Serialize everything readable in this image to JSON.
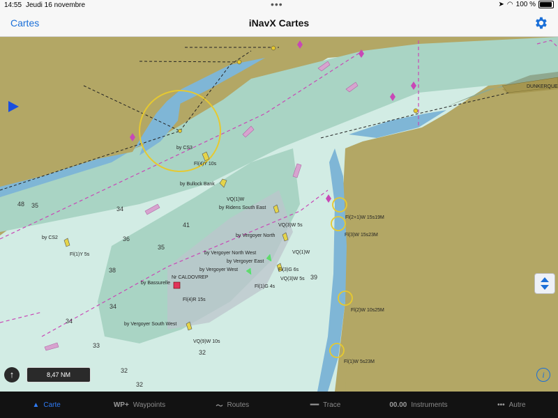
{
  "status": {
    "time": "14:55",
    "date": "Jeudi 16 novembre",
    "battery": "100 %"
  },
  "nav": {
    "back_label": "Cartes",
    "title": "iNavX Cartes"
  },
  "map": {
    "place_label": "DUNKERQUE",
    "scale_label": "8,47 NM",
    "info_label": "i",
    "labels": [
      "by CS3",
      "Fl(4)Y 10s",
      "by Bullock Bank",
      "VQ(1)W",
      "by Ridens South East",
      "VQ(3)W 5s",
      "by Vergoyer North",
      "VQ(1)W",
      "by Vergoyer North West",
      "by Vergoyer East",
      "by Vergoyer West",
      "Fl(3)G 6s",
      "VQ(3)W 5s",
      "by Bassurelle",
      "Nr CALDOVREP",
      "Fl(4)R 15s",
      "Fl(1)G 4s",
      "by Vergoyer South West",
      "VQ(9)W 10s",
      "by CS2",
      "Fl(1)Y 5s",
      "Fl(2+1)W 15s19M",
      "Fl(3)W 15s23M",
      "Fl(2)W 10s25M",
      "Fl(1)W 5s23M"
    ],
    "depths": [
      "48",
      "35",
      "34",
      "36",
      "41",
      "35",
      "38",
      "34",
      "32",
      "32",
      "34",
      "39",
      "33",
      "32"
    ]
  },
  "tabs": [
    {
      "id": "carte",
      "icon": "▲",
      "label": "Carte",
      "active": true
    },
    {
      "id": "waypoints",
      "icon": "WP+",
      "label": "Waypoints"
    },
    {
      "id": "routes",
      "icon": "〜",
      "label": "Routes"
    },
    {
      "id": "trace",
      "icon": "━━",
      "label": "Trace"
    },
    {
      "id": "instruments",
      "icon": "00.00",
      "label": "Instruments"
    },
    {
      "id": "autre",
      "icon": "•••",
      "label": "Autre"
    }
  ],
  "colors": {
    "accent": "#1a6fd8",
    "land": "#b3a765",
    "shallow": "#7fb6d6",
    "deep": "#d2ece4"
  }
}
